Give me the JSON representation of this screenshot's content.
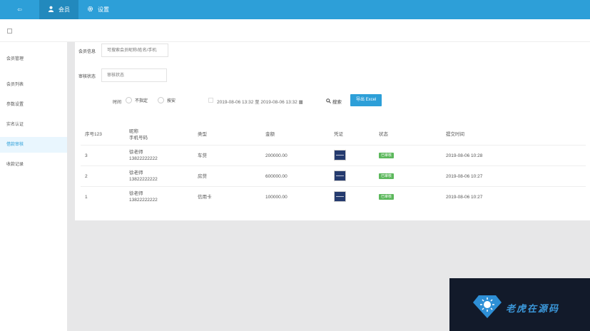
{
  "header": {
    "collapse_symbol": "⇦",
    "nav": [
      {
        "label": "会员",
        "icon": "user-icon"
      },
      {
        "label": "设置",
        "icon": "gear-icon"
      }
    ]
  },
  "sidebar": {
    "items": [
      {
        "label": "会员管理"
      },
      {
        "label": "会员列表"
      },
      {
        "label": "参数设置"
      },
      {
        "label": "实名认证"
      },
      {
        "label": "借款审核"
      },
      {
        "label": "收款记录"
      }
    ]
  },
  "filters": {
    "member_label": "会员信息",
    "member_placeholder": "可搜索会员昵称/姓名/手机",
    "status_label": "审核状态",
    "status_placeholder": "审核状态",
    "time_label": "时间",
    "time_options": [
      "不指定",
      "按安"
    ],
    "date_range": "2019-08-06 13:32 至 2019-08-06 13:32",
    "search_label": "搜索",
    "export_label": "导出 Excel"
  },
  "table": {
    "headers": {
      "id": "序号123",
      "name_line1": "昵称",
      "name_line2": "手机号码",
      "type": "类型",
      "amount": "金额",
      "proof": "凭证",
      "status": "状态",
      "time": "提交时间"
    },
    "rows": [
      {
        "id": "3",
        "name": "徐老师",
        "phone": "13822222222",
        "type": "车贷",
        "amount": "200000.00",
        "status": "已审核",
        "time": "2019-08-06 10:28"
      },
      {
        "id": "2",
        "name": "徐老师",
        "phone": "13822222222",
        "type": "房贷",
        "amount": "600000.00",
        "status": "已审核",
        "time": "2019-08-06 10:27"
      },
      {
        "id": "1",
        "name": "徐老师",
        "phone": "13822222222",
        "type": "信用卡",
        "amount": "100000.00",
        "status": "已审核",
        "time": "2019-08-06 10:27"
      }
    ]
  },
  "watermark": {
    "text": "老虎在源码"
  },
  "colors": {
    "primary": "#2d9fd8",
    "success": "#5cb85c"
  }
}
